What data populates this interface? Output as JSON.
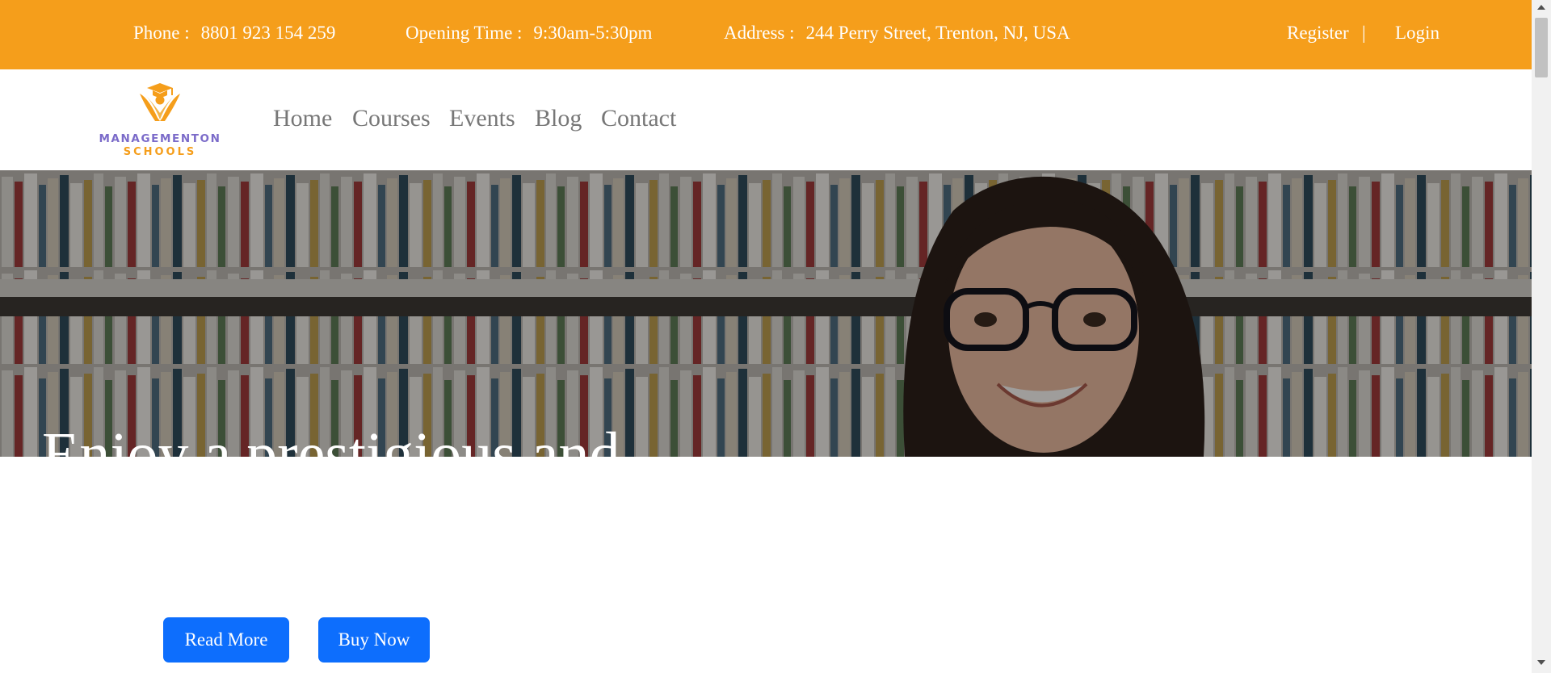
{
  "topbar": {
    "phone_label": "Phone :",
    "phone_value": "8801 923 154 259",
    "hours_label": "Opening Time :",
    "hours_value": "9:30am-5:30pm",
    "address_label": "Address :",
    "address_value": "244 Perry Street, Trenton, NJ, USA",
    "register_label": "Register",
    "separator": "|",
    "login_label": "Login"
  },
  "logo": {
    "line1": "MANAGEMENTON",
    "line2": "SCHOOLS",
    "colors": {
      "primary": "#7b6bc9",
      "accent": "#f59e1b"
    }
  },
  "nav": {
    "items": [
      {
        "label": "Home"
      },
      {
        "label": "Courses"
      },
      {
        "label": "Events"
      },
      {
        "label": "Blog"
      },
      {
        "label": "Contact"
      }
    ]
  },
  "hero": {
    "title": "Enjoy a prestigious and",
    "image": "student-with-glasses-in-library"
  },
  "actions": {
    "read_more": "Read More",
    "buy_now": "Buy Now"
  },
  "colors": {
    "topbar_bg": "#f59e1b",
    "button_bg": "#0d6efd",
    "nav_text": "#777777"
  }
}
